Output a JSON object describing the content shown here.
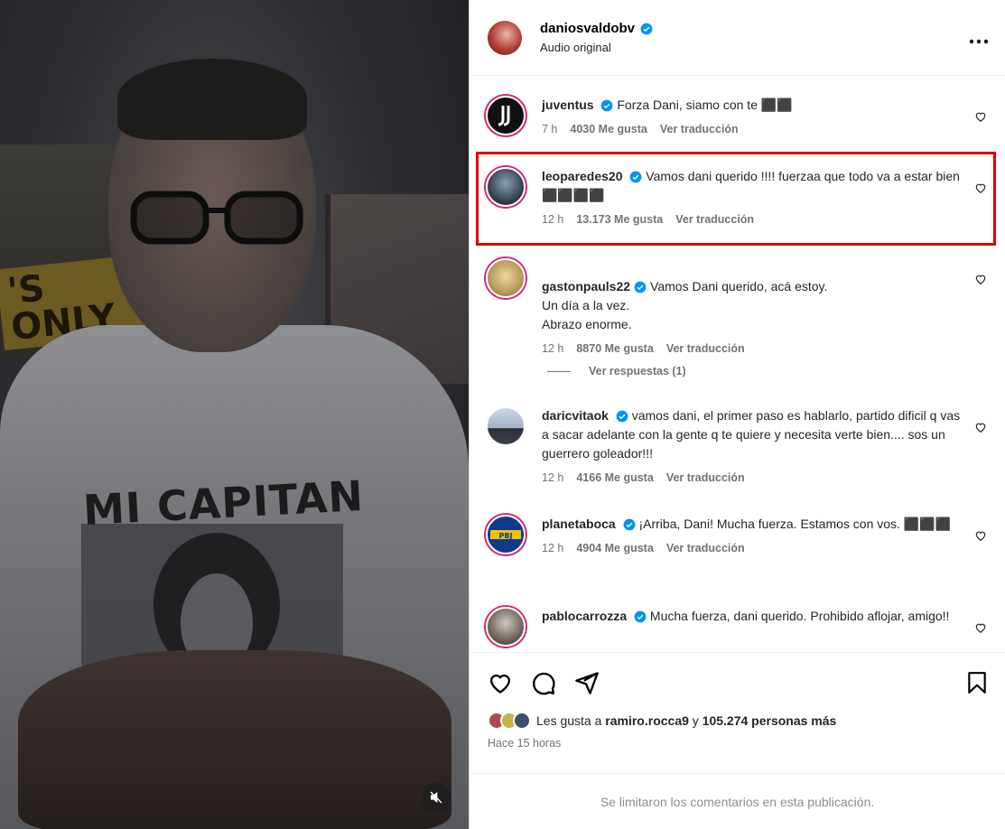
{
  "post": {
    "username": "daniosvaldobv",
    "subtitle": "Audio original",
    "more_label": "•••"
  },
  "video": {
    "poster_text": "'S\nONLY",
    "shirt_text": "MI CAPITAN"
  },
  "comments": [
    {
      "username": "juventus",
      "text": "Forza Dani, siamo con te ⬛⬛",
      "time": "7 h",
      "likes": "4030 Me gusta",
      "translate": "Ver traducción"
    },
    {
      "username": "leoparedes20",
      "text": "Vamos dani querido !!!! fuerzaa que todo va a estar bien ⬛⬛⬛⬛",
      "time": "12 h",
      "likes": "13.173 Me gusta",
      "translate": "Ver traducción"
    },
    {
      "username": "gastonpauls22",
      "text": "Vamos Dani querido, acá estoy.\nUn día a la vez.\nAbrazo enorme.",
      "time": "12 h",
      "likes": "8870 Me gusta",
      "translate": "Ver traducción"
    },
    {
      "username": "daricvitaok",
      "text": "vamos dani, el primer paso es hablarlo, partido dificil q vas a sacar adelante con la gente q te quiere y necesita verte bien.... sos un guerrero goleador!!!",
      "time": "12 h",
      "likes": "4166 Me gusta",
      "translate": "Ver traducción"
    },
    {
      "username": "planetaboca",
      "text": "¡Arriba, Dani! Mucha fuerza. Estamos con vos. ⬛⬛⬛",
      "time": "12 h",
      "likes": "4904 Me gusta",
      "translate": "Ver traducción"
    },
    {
      "username": "pablocarrozza",
      "text": "Mucha fuerza, dani querido. Prohibido aflojar, amigo!!",
      "time": "",
      "likes": "",
      "translate": ""
    }
  ],
  "replies_label": "Ver respuestas (1)",
  "likes_summary": {
    "prefix": "Les gusta a ",
    "user": "ramiro.rocca9",
    "middle": " y ",
    "count": "105.274 personas más"
  },
  "time_ago": "Hace 15 horas",
  "footer_text": "Se limitaron los comentarios en esta publicación.",
  "colors": {
    "verified": "#0095f6",
    "highlight": "#e00000",
    "muted_text": "#737373"
  },
  "icons": [
    "heart-icon",
    "comment-icon",
    "share-icon",
    "bookmark-icon",
    "verified-icon",
    "mute-icon",
    "more-icon"
  ]
}
